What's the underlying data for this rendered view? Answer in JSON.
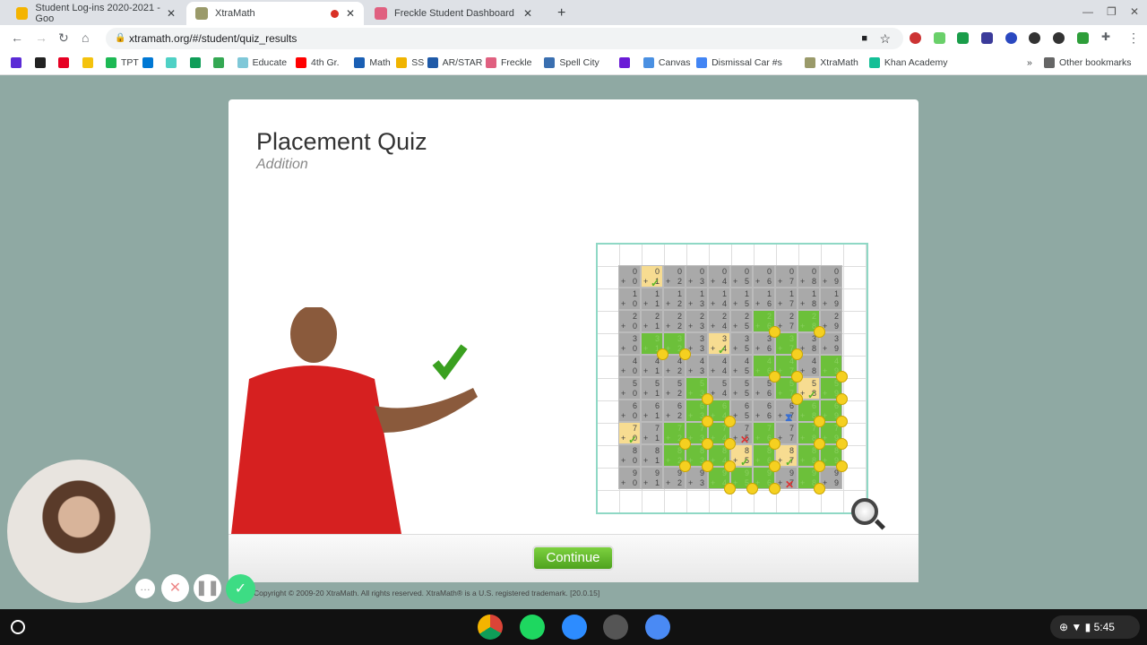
{
  "browser": {
    "tabs": [
      {
        "label": "Student Log-ins 2020-2021 - Goo",
        "icon": "google-slides-icon",
        "color": "#f4b400",
        "active": false
      },
      {
        "label": "XtraMath",
        "icon": "xtramath-icon",
        "color": "#9a9a6a",
        "active": true,
        "recording": true
      },
      {
        "label": "Freckle Student Dashboard",
        "icon": "freckle-icon",
        "color": "#e06080",
        "active": false
      }
    ],
    "url": "xtramath.org/#/student/quiz_results",
    "bookmarks": [
      {
        "label": "",
        "color": "#5b2bd6"
      },
      {
        "label": "",
        "color": "#222"
      },
      {
        "label": "",
        "color": "#e60023"
      },
      {
        "label": "",
        "color": "#f4c20d"
      },
      {
        "label": "TPT",
        "color": "#1db954"
      },
      {
        "label": "",
        "color": "#0078d4"
      },
      {
        "label": "",
        "color": "#4fd1c5"
      },
      {
        "label": "",
        "color": "#0f9d58"
      },
      {
        "label": "",
        "color": "#34a853"
      },
      {
        "label": "Educate",
        "color": "#7fc8d8"
      },
      {
        "label": "4th Gr.",
        "color": "#ff0000"
      },
      {
        "label": "Math",
        "color": "#1a5fb4"
      },
      {
        "label": "SS",
        "color": "#f0b400"
      },
      {
        "label": "AR/STAR",
        "color": "#1f5aa8"
      },
      {
        "label": "Freckle",
        "color": "#e06080"
      },
      {
        "label": "Spell City",
        "color": "#3a6fb0"
      },
      {
        "label": "",
        "color": "#6a1bd6"
      },
      {
        "label": "Canvas",
        "color": "#4a90e2"
      },
      {
        "label": "Dismissal Car #s",
        "color": "#4285f4"
      },
      {
        "label": "XtraMath",
        "color": "#9a9a6a"
      },
      {
        "label": "Khan Academy",
        "color": "#14bf96"
      }
    ],
    "other_bookmarks": "Other bookmarks"
  },
  "quiz": {
    "title": "Placement Quiz",
    "subtitle": "Addition",
    "continue_label": "Continue",
    "grid_rows": [
      "gygggggggg",
      "gggggggggg",
      "ggggggGgGg",
      "gGGgyggGgg",
      "ggggggGGgG",
      "gggGgggGyG",
      "gggGGgghGG",
      "ygGGGxGgGG",
      "ggGGGyGyGG",
      "ggggGGGxGg"
    ],
    "colors": {
      "gray": "#a9a9a9",
      "green": "#6cc03a",
      "yellow": "#f7dc91",
      "border": "#8fd8c5"
    }
  },
  "footer": {
    "copyright": "Copyright © 2009-20 XtraMath. All rights reserved. XtraMath® is a U.S. registered trademark. [20.0.15]"
  },
  "taskbar": {
    "time": "5:45",
    "apps": [
      "chrome",
      "spotify",
      "zoom",
      "camera",
      "settings"
    ]
  },
  "recorder": {
    "controls": [
      "more",
      "cancel",
      "pause",
      "done"
    ]
  }
}
